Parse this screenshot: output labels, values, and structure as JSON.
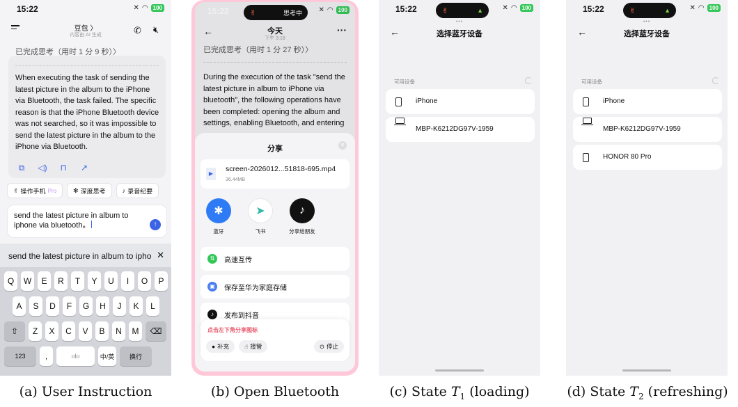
{
  "phone_a": {
    "status": {
      "time": "15:22",
      "battery": "100"
    },
    "header": {
      "title": "豆包 〉",
      "subtitle": "内容由 AI 生成"
    },
    "thinking": "已完成思考（用时 1 分 9 秒）〉",
    "response": "When executing the task of sending the latest picture in the album to the iPhone via Bluetooth, the task failed. The specific reason is that the iPhone Bluetooth device was not searched, so it was impossible to send the latest picture in the album to the iPhone via Bluetooth.",
    "chips": [
      {
        "label": "操作手机",
        "badge": "Pro"
      },
      {
        "label": "深度思考"
      },
      {
        "label": "录音纪要"
      }
    ],
    "input": {
      "value": "send the latest picture in album to iphone via bluetooth。"
    },
    "keyboard": {
      "suggestion": "send the latest picture in album to iphone",
      "row1": [
        "Q",
        "W",
        "E",
        "R",
        "T",
        "Y",
        "U",
        "I",
        "O",
        "P"
      ],
      "row2": [
        "A",
        "S",
        "D",
        "F",
        "G",
        "H",
        "J",
        "K",
        "L"
      ],
      "row3": [
        "Z",
        "X",
        "C",
        "V",
        "B",
        "N",
        "M"
      ],
      "num": "123",
      "punct": ",",
      "lang": "中/英",
      "enter": "换行"
    }
  },
  "phone_b": {
    "island": "思考中",
    "status": {
      "time": "15:22",
      "battery": "100"
    },
    "header": {
      "title": "今天",
      "subtitle": "下午 3:18"
    },
    "thinking": "已完成思考（用时 1 分 27 秒）〉",
    "response": "During the execution of the task \"send the latest picture in album to iPhone via bluetooth\", the following operations have been completed: opening the album and settings, enabling Bluetooth, and entering",
    "sheet": {
      "title": "分享",
      "file_name": "screen-2026012...51818-695.mp4",
      "file_size": "36.44MB",
      "apps": [
        {
          "label": "蓝牙",
          "color": "#2f7bf5"
        },
        {
          "label": "飞书",
          "color": "#ffffff"
        },
        {
          "label": "分享给朋友",
          "color": "#111111"
        }
      ],
      "options": [
        "高速互传",
        "保存至华为家庭存储",
        "发布到抖音"
      ]
    },
    "overlay": {
      "hint": "点击左下角分享图标",
      "pills": [
        "补充",
        "接管"
      ],
      "stop": "停止"
    }
  },
  "phone_c": {
    "status": {
      "time": "15:22",
      "battery": "100"
    },
    "title": "选择蓝牙设备",
    "section": "可用设备",
    "devices": [
      {
        "name": "iPhone",
        "kind": "phone"
      },
      {
        "name": "MBP-K6212DG97V-1959",
        "kind": "laptop"
      }
    ]
  },
  "phone_d": {
    "status": {
      "time": "15:22",
      "battery": "100"
    },
    "title": "选择蓝牙设备",
    "section": "可用设备",
    "devices": [
      {
        "name": "iPhone",
        "kind": "phone"
      },
      {
        "name": "MBP-K6212DG97V-1959",
        "kind": "laptop"
      },
      {
        "name": "HONOR 80 Pro",
        "kind": "phone"
      }
    ]
  },
  "captions": {
    "a": "(a) User Instruction",
    "b": "(b) Open Bluetooth",
    "c_prefix": "(c) State ",
    "c_var": "T",
    "c_sub": "1",
    "c_suffix": " (loading)",
    "d_prefix": "(d) State ",
    "d_var": "T",
    "d_sub": "2",
    "d_suffix": " (refreshing)"
  }
}
